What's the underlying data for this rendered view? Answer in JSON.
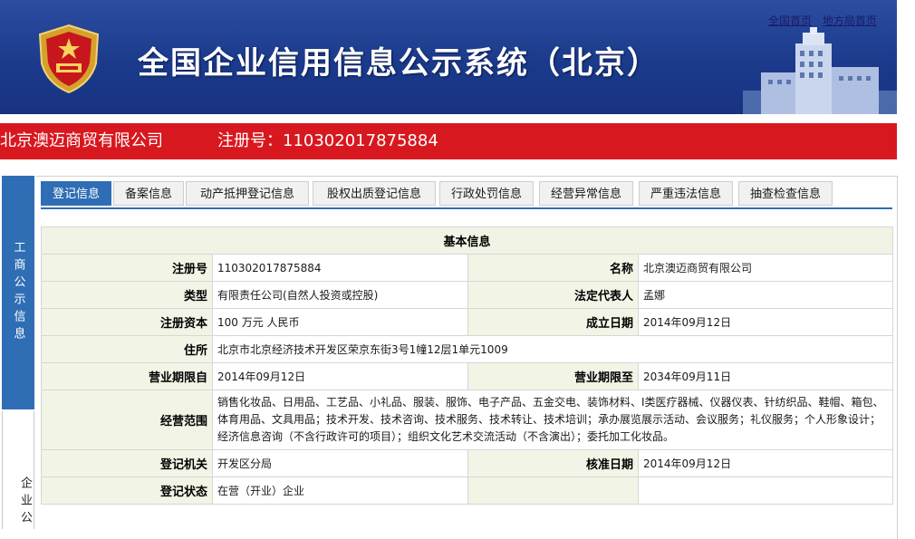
{
  "header": {
    "title": "全国企业信用信息公示系统（北京）",
    "links": [
      "全国首页",
      "地方局首页"
    ]
  },
  "company_bar": {
    "name": "北京澳迈商贸有限公司",
    "reg_label": "注册号：",
    "reg_no": "110302017875884"
  },
  "sidebar": {
    "gongshang": "工商公示信息",
    "qiye": "企业公"
  },
  "tabs": [
    "登记信息",
    "备案信息",
    "动产抵押登记信息",
    "股权出质登记信息",
    "行政处罚信息",
    "经营异常信息",
    "严重违法信息",
    "抽查检查信息"
  ],
  "table": {
    "title": "基本信息",
    "rows": [
      {
        "l1": "注册号",
        "v1": "110302017875884",
        "l2": "名称",
        "v2": "北京澳迈商贸有限公司"
      },
      {
        "l1": "类型",
        "v1": "有限责任公司(自然人投资或控股)",
        "l2": "法定代表人",
        "v2": "孟娜"
      },
      {
        "l1": "注册资本",
        "v1": "100 万元 人民币",
        "l2": "成立日期",
        "v2": "2014年09月12日"
      },
      {
        "l1": "住所",
        "v1": "北京市北京经济技术开发区荣京东街3号1幢12层1单元1009"
      },
      {
        "l1": "营业期限自",
        "v1": "2014年09月12日",
        "l2": "营业期限至",
        "v2": "2034年09月11日"
      },
      {
        "l1": "经营范围",
        "v1": "销售化妆品、日用品、工艺品、小礼品、服装、服饰、电子产品、五金交电、装饰材料、I类医疗器械、仪器仪表、针纺织品、鞋帽、箱包、体育用品、文具用品；技术开发、技术咨询、技术服务、技术转让、技术培训；承办展览展示活动、会议服务；礼仪服务；个人形象设计；经济信息咨询（不含行政许可的项目）；组织文化艺术交流活动（不含演出）；委托加工化妆品。"
      },
      {
        "l1": "登记机关",
        "v1": "开发区分局",
        "l2": "核准日期",
        "v2": "2014年09月12日"
      },
      {
        "l1": "登记状态",
        "v1": "在营（开业）企业",
        "l2": "",
        "v2": ""
      }
    ]
  },
  "colors": {
    "header_blue": "#1b3a8c",
    "red_bar": "#d8181f",
    "tab_active": "#2f6eb5",
    "label_bg": "#f2f5e6"
  }
}
